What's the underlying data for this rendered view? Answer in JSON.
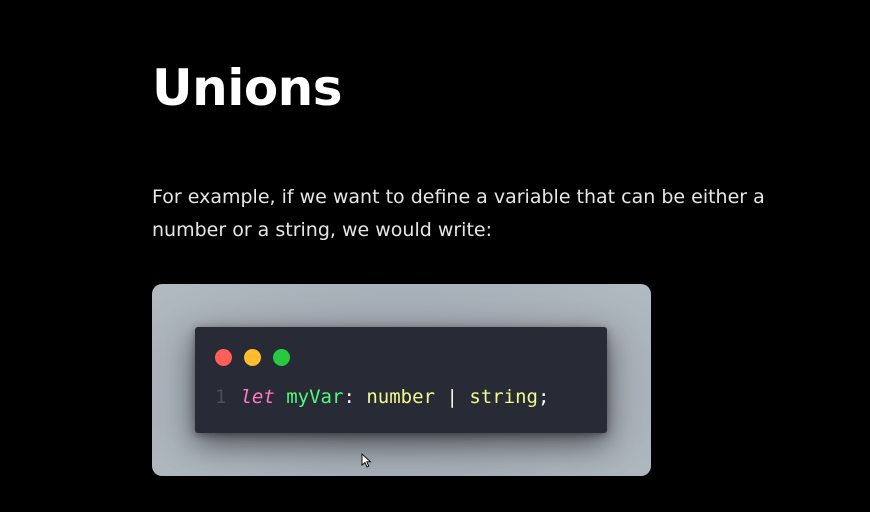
{
  "slide": {
    "title": "Unions",
    "paragraph": "For example, if we want to define a variable that can be either a number or a string, we would write:"
  },
  "code_window": {
    "window_controls": {
      "close_color": "#ff5f56",
      "minimize_color": "#ffbd2e",
      "maximize_color": "#27c93f"
    },
    "line_number": "1",
    "tokens": {
      "keyword": "let",
      "identifier": "myVar",
      "colon": ":",
      "type1": "number",
      "pipe": "|",
      "type2": "string",
      "semicolon": ";"
    }
  },
  "colors": {
    "background": "#000000",
    "code_background": "#282a36",
    "keyword": "#ff79c6",
    "identifier": "#50fa7b",
    "type": "#f1fa8c"
  },
  "icons": {
    "cursor": "mouse-pointer-icon"
  }
}
